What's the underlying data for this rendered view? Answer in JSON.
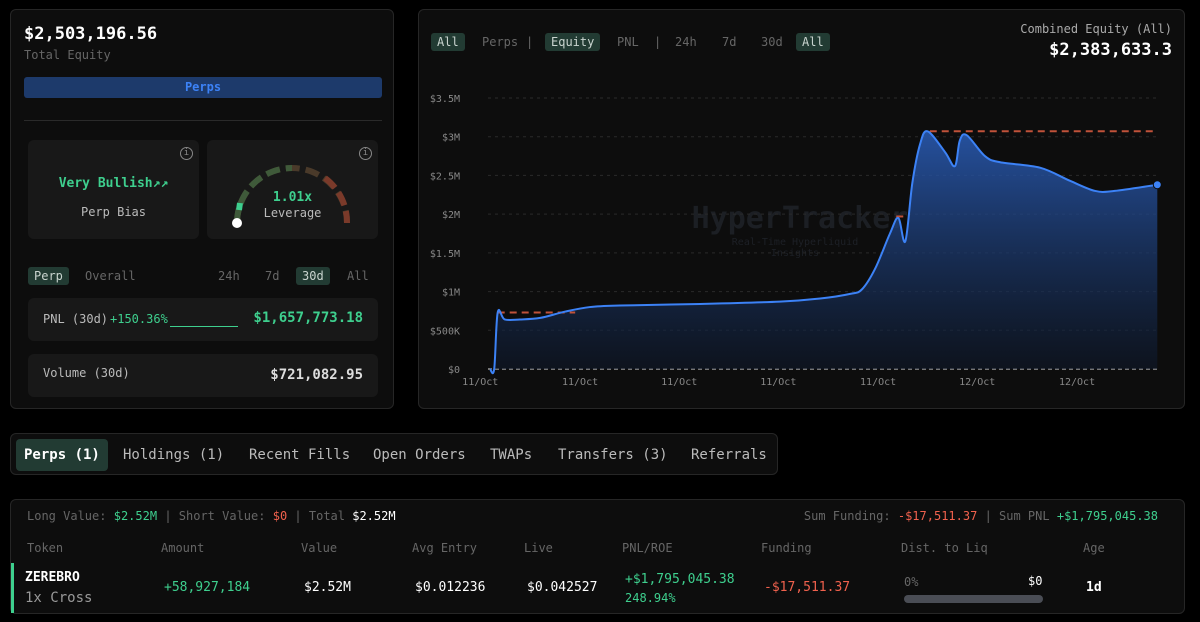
{
  "summary": {
    "total_equity": "$2,503,196.56",
    "total_equity_label": "Total Equity",
    "perps_tab": "Perps"
  },
  "bias": {
    "value": "Very Bullish",
    "label": "Perp Bias",
    "icon": "trending-up-icon"
  },
  "leverage": {
    "value": "1.01x",
    "label": "Leverage",
    "gauge_fraction": 0.02
  },
  "pnl_filters": {
    "scope": [
      "Perp",
      "Overall"
    ],
    "scope_selected": "Perp",
    "ranges": [
      "24h",
      "7d",
      "30d",
      "All"
    ],
    "range_selected": "30d"
  },
  "pnl": {
    "label": "PNL (30d)",
    "pct": "+150.36%",
    "value": "$1,657,773.18"
  },
  "volume": {
    "label": "Volume (30d)",
    "value": "$721,082.95"
  },
  "chart_controls": {
    "scope": [
      "All",
      "Perps"
    ],
    "scope_selected": "All",
    "metric": [
      "Equity",
      "PNL"
    ],
    "metric_selected": "Equity",
    "ranges": [
      "24h",
      "7d",
      "30d",
      "All"
    ],
    "range_selected": "All",
    "sep": "|"
  },
  "combined": {
    "label": "Combined Equity (All)",
    "value": "$2,383,633.3"
  },
  "watermark": {
    "title": "HyperTracker",
    "sub1": "Real-Time Hyperliquid",
    "sub2": "Insights"
  },
  "chart_data": {
    "type": "area",
    "title": "Combined Equity (All)",
    "ylim": [
      0,
      3500000
    ],
    "xlim": [
      0,
      100
    ],
    "yticks": [
      {
        "v": 0,
        "l": "$0"
      },
      {
        "v": 500000,
        "l": "$500K"
      },
      {
        "v": 1000000,
        "l": "$1M"
      },
      {
        "v": 1500000,
        "l": "$1.5M"
      },
      {
        "v": 2000000,
        "l": "$2M"
      },
      {
        "v": 2500000,
        "l": "$2.5M"
      },
      {
        "v": 3000000,
        "l": "$3M"
      },
      {
        "v": 3500000,
        "l": "$3.5M"
      }
    ],
    "xticks": [
      {
        "v": 2.9,
        "l": "11/Oct"
      },
      {
        "v": 17.2,
        "l": "11/Oct"
      },
      {
        "v": 31.4,
        "l": "11/Oct"
      },
      {
        "v": 45.6,
        "l": "11/Oct"
      },
      {
        "v": 59.9,
        "l": "11/Oct"
      },
      {
        "v": 74.1,
        "l": "12/Oct"
      },
      {
        "v": 88.4,
        "l": "12/Oct"
      }
    ],
    "x": [
      4.3,
      4.9,
      5.4,
      6.4,
      8.6,
      11.5,
      15,
      18.6,
      22.9,
      34.4,
      45.8,
      51.6,
      55.9,
      57.6,
      59.5,
      61.6,
      62.8,
      63.8,
      64.8,
      65.9,
      67,
      69.5,
      70.9,
      71.6,
      72.6,
      75.2,
      77.4,
      83.1,
      87.4,
      91,
      93.8,
      99.9
    ],
    "y": [
      0,
      0,
      730000,
      640000,
      640000,
      660000,
      740000,
      800000,
      820000,
      840000,
      870000,
      910000,
      970000,
      1030000,
      1300000,
      1750000,
      1950000,
      1650000,
      2400000,
      2900000,
      3070000,
      2800000,
      2620000,
      2950000,
      3020000,
      2750000,
      2670000,
      2600000,
      2430000,
      2300000,
      2300000,
      2380000
    ],
    "peak_lines": [
      {
        "x0": 5.4,
        "x1": 16.5,
        "y": 730000
      },
      {
        "x0": 62.5,
        "x1": 64,
        "y": 1970000
      },
      {
        "x0": 67.3,
        "x1": 99.9,
        "y": 3070000
      }
    ]
  },
  "tabs": [
    "Perps (1)",
    "Holdings (1)",
    "Recent Fills",
    "Open Orders",
    "TWAPs",
    "Transfers (3)",
    "Referrals"
  ],
  "positions_summary": {
    "long_label": "Long Value:",
    "long": "$2.52M",
    "short_label": "Short Value:",
    "short": "$0",
    "total_label": "Total",
    "total": "$2.52M",
    "funding_label": "Sum Funding:",
    "funding": "-$17,511.37",
    "pnl_label": "Sum PNL",
    "pnl": "+$1,795,045.38"
  },
  "columns": [
    "Token",
    "Amount",
    "Value",
    "Avg Entry",
    "Live",
    "PNL/ROE",
    "Funding",
    "Dist. to Liq",
    "Age"
  ],
  "rows": [
    {
      "token": "ZEREBRO",
      "mode": "1x Cross",
      "amount": "+58,927,184",
      "value": "$2.52M",
      "entry": "$0.012236",
      "live": "$0.042527",
      "pnl": "+$1,795,045.38",
      "roe": "248.94%",
      "funding": "-$17,511.37",
      "liq_pct": "0%",
      "liq_val": "$0",
      "age": "1d"
    }
  ]
}
